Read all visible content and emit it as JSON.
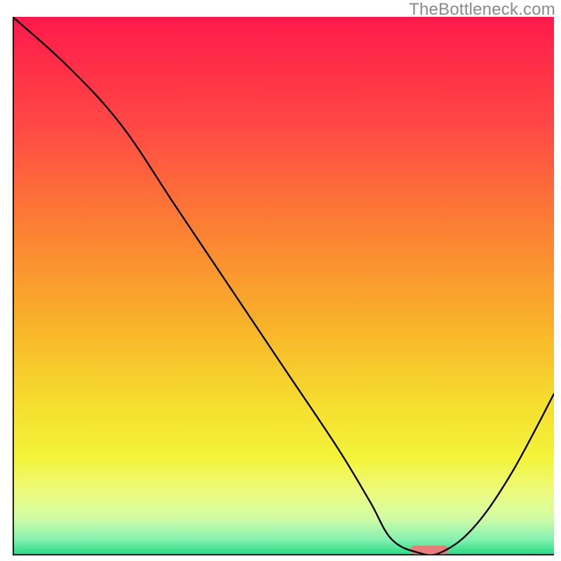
{
  "watermark": "TheBottleneck.com",
  "chart_data": {
    "type": "line",
    "title": "",
    "xlabel": "",
    "ylabel": "",
    "xlim": [
      0,
      100
    ],
    "ylim": [
      0,
      100
    ],
    "series": [
      {
        "name": "curve",
        "x": [
          0,
          10,
          20,
          30,
          40,
          50,
          60,
          66,
          70,
          75,
          79,
          85,
          92,
          100
        ],
        "y": [
          100,
          91,
          80,
          65,
          50,
          35,
          20,
          10,
          3,
          0.5,
          0.5,
          5,
          15,
          30
        ]
      }
    ],
    "marker": {
      "x": 77,
      "y": 0.2,
      "width": 7,
      "height": 1.6,
      "color": "#e77d7a"
    },
    "gradient_stops": [
      {
        "offset": 0.0,
        "color": "#ff1a4b"
      },
      {
        "offset": 0.2,
        "color": "#ff4845"
      },
      {
        "offset": 0.4,
        "color": "#fc8233"
      },
      {
        "offset": 0.58,
        "color": "#f8b52a"
      },
      {
        "offset": 0.72,
        "color": "#f6de2f"
      },
      {
        "offset": 0.82,
        "color": "#f4f43b"
      },
      {
        "offset": 0.88,
        "color": "#eefb7b"
      },
      {
        "offset": 0.93,
        "color": "#d3fca5"
      },
      {
        "offset": 0.97,
        "color": "#86f2b0"
      },
      {
        "offset": 1.0,
        "color": "#23d882"
      }
    ]
  }
}
